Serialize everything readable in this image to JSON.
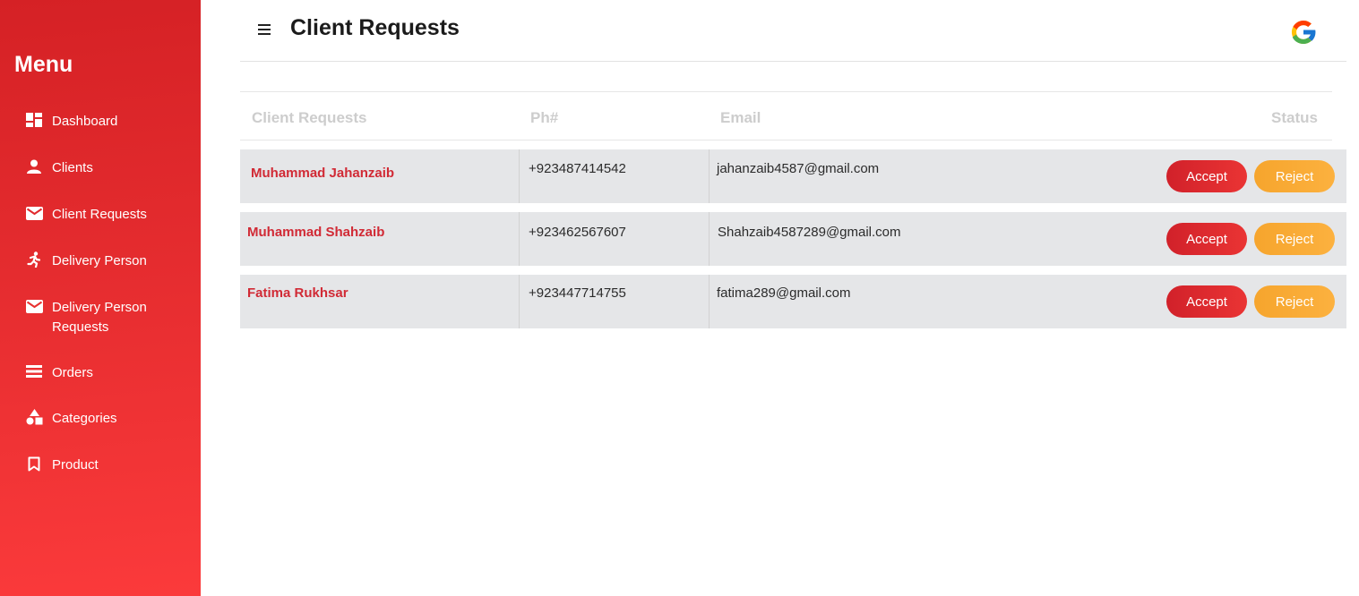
{
  "sidebar": {
    "title": "Menu",
    "items": [
      {
        "label": "Dashboard",
        "icon": "dashboard-icon"
      },
      {
        "label": "Clients",
        "icon": "user-icon"
      },
      {
        "label": "Client Requests",
        "icon": "mail-icon"
      },
      {
        "label": "Delivery Person",
        "icon": "running-person-icon"
      },
      {
        "label": "Delivery Person Requests",
        "icon": "mail-icon"
      },
      {
        "label": "Orders",
        "icon": "list-icon"
      },
      {
        "label": "Categories",
        "icon": "shapes-icon"
      },
      {
        "label": "Product",
        "icon": "bookmark-icon"
      }
    ],
    "colors": {
      "gradient_start": "#d52125",
      "gradient_end": "#fb3a3b"
    }
  },
  "header": {
    "title": "Client Requests",
    "menu_icon": "hamburger-icon",
    "account_icon": "google-icon"
  },
  "table": {
    "columns": [
      "Client Requests",
      "Ph#",
      "Email",
      "Status"
    ],
    "rows": [
      {
        "name": "Muhammad Jahanzaib",
        "phone": "+923487414542",
        "email": "jahanzaib4587@gmail.com",
        "accept": "Accept",
        "reject": "Reject"
      },
      {
        "name": "Muhammad Shahzaib",
        "phone": "+923462567607",
        "email": "Shahzaib4587289@gmail.com",
        "accept": "Accept",
        "reject": "Reject"
      },
      {
        "name": "Fatima Rukhsar",
        "phone": "+923447714755",
        "email": "fatima289@gmail.com",
        "accept": "Accept",
        "reject": "Reject"
      }
    ]
  },
  "colors": {
    "accent": "#d12a35",
    "accept": "#e02a30",
    "reject": "#f8aa33",
    "row_bg": "#e5e6e8"
  }
}
